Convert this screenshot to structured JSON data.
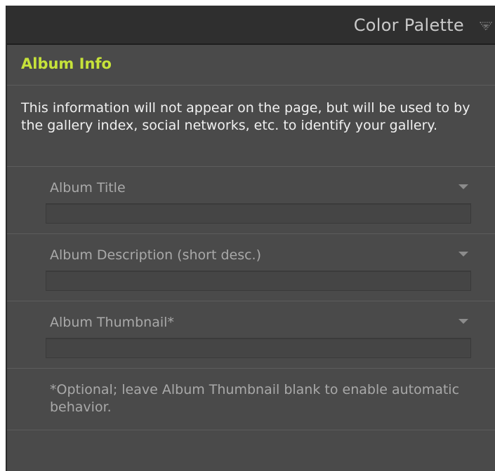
{
  "panel": {
    "title": "Color Palette",
    "toggle_icon": "collapse-triangle-icon"
  },
  "section": {
    "title": "Album Info",
    "title_color": "#c6e23a",
    "intro": "This information will not appear on the page, but will be used to by the gallery index, social networks, etc. to identify your gallery."
  },
  "fields": [
    {
      "label": "Album Title",
      "value": "",
      "icon": "dropdown-arrow-icon"
    },
    {
      "label": "Album Description (short desc.)",
      "value": "",
      "icon": "dropdown-arrow-icon"
    },
    {
      "label": "Album Thumbnail*",
      "value": "",
      "icon": "dropdown-arrow-icon"
    }
  ],
  "footnote": "*Optional; leave Album Thumbnail blank to enable automatic behavior."
}
